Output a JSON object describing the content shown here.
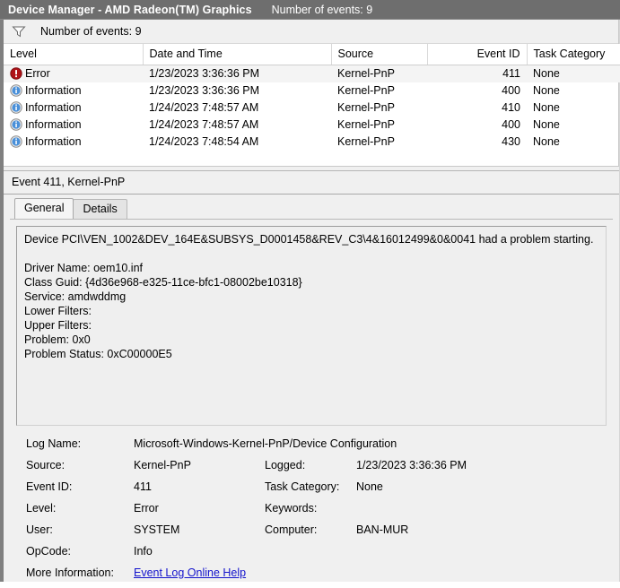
{
  "titlebar": {
    "title": "Device Manager - AMD Radeon(TM) Graphics",
    "subtitle": "Number of events: 9"
  },
  "filterbar": {
    "icon": "filter-funnel-icon",
    "label": "Number of events: 9"
  },
  "events_table": {
    "columns": [
      {
        "label": "Level",
        "align": "left"
      },
      {
        "label": "Date and Time",
        "align": "left"
      },
      {
        "label": "Source",
        "align": "left"
      },
      {
        "label": "Event ID",
        "align": "right"
      },
      {
        "label": "Task Category",
        "align": "left"
      }
    ],
    "rows": [
      {
        "icon": "error-icon",
        "level": "Error",
        "datetime": "1/23/2023 3:36:36 PM",
        "source": "Kernel-PnP",
        "event_id": "411",
        "task_category": "None",
        "selected": true
      },
      {
        "icon": "information-icon",
        "level": "Information",
        "datetime": "1/23/2023 3:36:36 PM",
        "source": "Kernel-PnP",
        "event_id": "400",
        "task_category": "None",
        "selected": false
      },
      {
        "icon": "information-icon",
        "level": "Information",
        "datetime": "1/24/2023 7:48:57 AM",
        "source": "Kernel-PnP",
        "event_id": "410",
        "task_category": "None",
        "selected": false
      },
      {
        "icon": "information-icon",
        "level": "Information",
        "datetime": "1/24/2023 7:48:57 AM",
        "source": "Kernel-PnP",
        "event_id": "400",
        "task_category": "None",
        "selected": false
      },
      {
        "icon": "information-icon",
        "level": "Information",
        "datetime": "1/24/2023 7:48:54 AM",
        "source": "Kernel-PnP",
        "event_id": "430",
        "task_category": "None",
        "selected": false
      }
    ]
  },
  "details": {
    "header": "Event 411, Kernel-PnP",
    "tabs": [
      {
        "label": "General",
        "active": true
      },
      {
        "label": "Details",
        "active": false
      }
    ],
    "description": "Device PCI\\VEN_1002&DEV_164E&SUBSYS_D0001458&REV_C3\\4&16012499&0&0041 had a problem starting.\n\nDriver Name: oem10.inf\nClass Guid: {4d36e968-e325-11ce-bfc1-08002be10318}\nService: amdwddmg\nLower Filters: \nUpper Filters: \nProblem: 0x0\nProblem Status: 0xC00000E5",
    "info": {
      "log_name_label": "Log Name:",
      "log_name_value": "Microsoft-Windows-Kernel-PnP/Device Configuration",
      "source_label": "Source:",
      "source_value": "Kernel-PnP",
      "logged_label": "Logged:",
      "logged_value": "1/23/2023 3:36:36 PM",
      "event_id_label": "Event ID:",
      "event_id_value": "411",
      "task_category_label": "Task Category:",
      "task_category_value": "None",
      "level_label": "Level:",
      "level_value": "Error",
      "keywords_label": "Keywords:",
      "keywords_value": "",
      "user_label": "User:",
      "user_value": "SYSTEM",
      "computer_label": "Computer:",
      "computer_value": "BAN-MUR",
      "opcode_label": "OpCode:",
      "opcode_value": "Info",
      "more_info_label": "More Information:",
      "more_info_link": "Event Log Online Help"
    }
  },
  "colors": {
    "titlebar_bg": "#6e6e6e",
    "error_red": "#b01218",
    "info_blue": "#4a90d9",
    "link_blue": "#1414cc",
    "pane_bg": "#f0f0f0"
  }
}
